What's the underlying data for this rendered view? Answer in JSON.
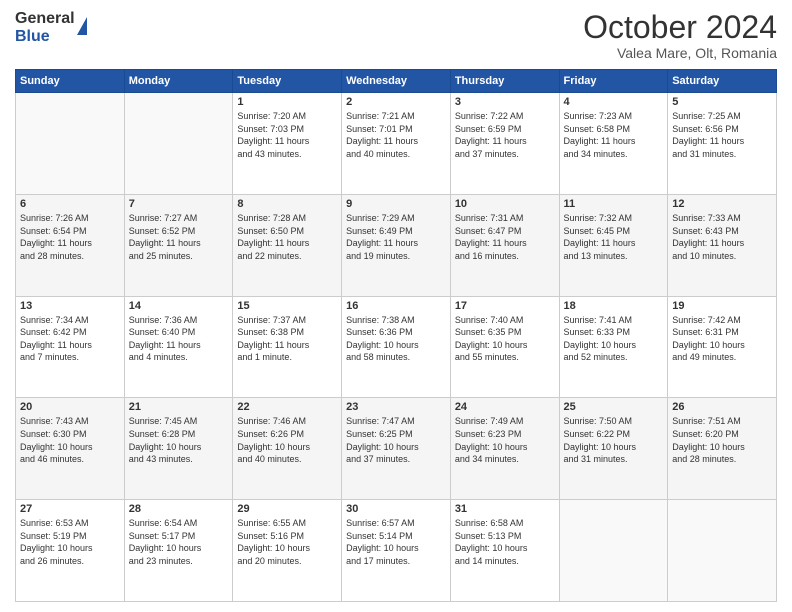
{
  "header": {
    "logo_line1": "General",
    "logo_line2": "Blue",
    "month_title": "October 2024",
    "location": "Valea Mare, Olt, Romania"
  },
  "calendar": {
    "days_of_week": [
      "Sunday",
      "Monday",
      "Tuesday",
      "Wednesday",
      "Thursday",
      "Friday",
      "Saturday"
    ],
    "weeks": [
      [
        {
          "day": "",
          "info": ""
        },
        {
          "day": "",
          "info": ""
        },
        {
          "day": "1",
          "info": "Sunrise: 7:20 AM\nSunset: 7:03 PM\nDaylight: 11 hours\nand 43 minutes."
        },
        {
          "day": "2",
          "info": "Sunrise: 7:21 AM\nSunset: 7:01 PM\nDaylight: 11 hours\nand 40 minutes."
        },
        {
          "day": "3",
          "info": "Sunrise: 7:22 AM\nSunset: 6:59 PM\nDaylight: 11 hours\nand 37 minutes."
        },
        {
          "day": "4",
          "info": "Sunrise: 7:23 AM\nSunset: 6:58 PM\nDaylight: 11 hours\nand 34 minutes."
        },
        {
          "day": "5",
          "info": "Sunrise: 7:25 AM\nSunset: 6:56 PM\nDaylight: 11 hours\nand 31 minutes."
        }
      ],
      [
        {
          "day": "6",
          "info": "Sunrise: 7:26 AM\nSunset: 6:54 PM\nDaylight: 11 hours\nand 28 minutes."
        },
        {
          "day": "7",
          "info": "Sunrise: 7:27 AM\nSunset: 6:52 PM\nDaylight: 11 hours\nand 25 minutes."
        },
        {
          "day": "8",
          "info": "Sunrise: 7:28 AM\nSunset: 6:50 PM\nDaylight: 11 hours\nand 22 minutes."
        },
        {
          "day": "9",
          "info": "Sunrise: 7:29 AM\nSunset: 6:49 PM\nDaylight: 11 hours\nand 19 minutes."
        },
        {
          "day": "10",
          "info": "Sunrise: 7:31 AM\nSunset: 6:47 PM\nDaylight: 11 hours\nand 16 minutes."
        },
        {
          "day": "11",
          "info": "Sunrise: 7:32 AM\nSunset: 6:45 PM\nDaylight: 11 hours\nand 13 minutes."
        },
        {
          "day": "12",
          "info": "Sunrise: 7:33 AM\nSunset: 6:43 PM\nDaylight: 11 hours\nand 10 minutes."
        }
      ],
      [
        {
          "day": "13",
          "info": "Sunrise: 7:34 AM\nSunset: 6:42 PM\nDaylight: 11 hours\nand 7 minutes."
        },
        {
          "day": "14",
          "info": "Sunrise: 7:36 AM\nSunset: 6:40 PM\nDaylight: 11 hours\nand 4 minutes."
        },
        {
          "day": "15",
          "info": "Sunrise: 7:37 AM\nSunset: 6:38 PM\nDaylight: 11 hours\nand 1 minute."
        },
        {
          "day": "16",
          "info": "Sunrise: 7:38 AM\nSunset: 6:36 PM\nDaylight: 10 hours\nand 58 minutes."
        },
        {
          "day": "17",
          "info": "Sunrise: 7:40 AM\nSunset: 6:35 PM\nDaylight: 10 hours\nand 55 minutes."
        },
        {
          "day": "18",
          "info": "Sunrise: 7:41 AM\nSunset: 6:33 PM\nDaylight: 10 hours\nand 52 minutes."
        },
        {
          "day": "19",
          "info": "Sunrise: 7:42 AM\nSunset: 6:31 PM\nDaylight: 10 hours\nand 49 minutes."
        }
      ],
      [
        {
          "day": "20",
          "info": "Sunrise: 7:43 AM\nSunset: 6:30 PM\nDaylight: 10 hours\nand 46 minutes."
        },
        {
          "day": "21",
          "info": "Sunrise: 7:45 AM\nSunset: 6:28 PM\nDaylight: 10 hours\nand 43 minutes."
        },
        {
          "day": "22",
          "info": "Sunrise: 7:46 AM\nSunset: 6:26 PM\nDaylight: 10 hours\nand 40 minutes."
        },
        {
          "day": "23",
          "info": "Sunrise: 7:47 AM\nSunset: 6:25 PM\nDaylight: 10 hours\nand 37 minutes."
        },
        {
          "day": "24",
          "info": "Sunrise: 7:49 AM\nSunset: 6:23 PM\nDaylight: 10 hours\nand 34 minutes."
        },
        {
          "day": "25",
          "info": "Sunrise: 7:50 AM\nSunset: 6:22 PM\nDaylight: 10 hours\nand 31 minutes."
        },
        {
          "day": "26",
          "info": "Sunrise: 7:51 AM\nSunset: 6:20 PM\nDaylight: 10 hours\nand 28 minutes."
        }
      ],
      [
        {
          "day": "27",
          "info": "Sunrise: 6:53 AM\nSunset: 5:19 PM\nDaylight: 10 hours\nand 26 minutes."
        },
        {
          "day": "28",
          "info": "Sunrise: 6:54 AM\nSunset: 5:17 PM\nDaylight: 10 hours\nand 23 minutes."
        },
        {
          "day": "29",
          "info": "Sunrise: 6:55 AM\nSunset: 5:16 PM\nDaylight: 10 hours\nand 20 minutes."
        },
        {
          "day": "30",
          "info": "Sunrise: 6:57 AM\nSunset: 5:14 PM\nDaylight: 10 hours\nand 17 minutes."
        },
        {
          "day": "31",
          "info": "Sunrise: 6:58 AM\nSunset: 5:13 PM\nDaylight: 10 hours\nand 14 minutes."
        },
        {
          "day": "",
          "info": ""
        },
        {
          "day": "",
          "info": ""
        }
      ]
    ]
  }
}
